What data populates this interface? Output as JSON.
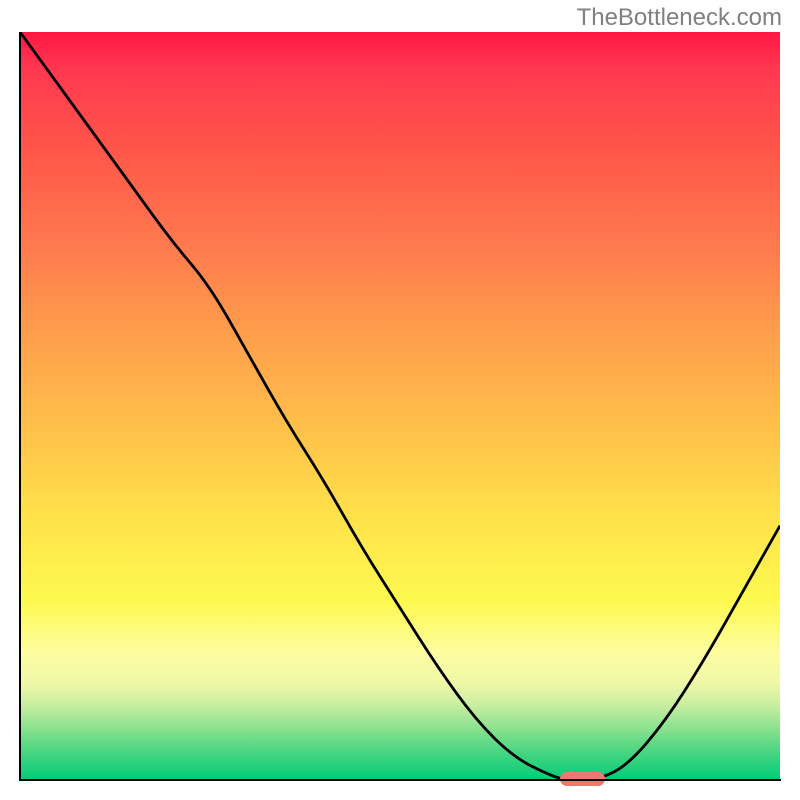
{
  "watermark": "TheBottleneck.com",
  "chart_data": {
    "type": "line",
    "title": "",
    "xlabel": "",
    "ylabel": "",
    "xlim": [
      0,
      100
    ],
    "ylim": [
      0,
      100
    ],
    "grid": false,
    "legend": false,
    "background_gradient": {
      "type": "vertical",
      "stops": [
        {
          "pos": 0,
          "color": "#ff1744",
          "meaning": "high"
        },
        {
          "pos": 50,
          "color": "#ffc04a",
          "meaning": "mid"
        },
        {
          "pos": 100,
          "color": "#00cc78",
          "meaning": "low"
        }
      ]
    },
    "series": [
      {
        "name": "bottleneck-curve",
        "color": "#000000",
        "x": [
          0,
          5,
          10,
          15,
          20,
          25,
          30,
          35,
          40,
          45,
          50,
          55,
          60,
          65,
          70,
          72,
          76,
          80,
          85,
          90,
          95,
          100
        ],
        "y": [
          100,
          93,
          86,
          79,
          72,
          66,
          57,
          48,
          40,
          31,
          23,
          15,
          8,
          3,
          0.5,
          0,
          0,
          2,
          8,
          16,
          25,
          34
        ]
      }
    ],
    "marker": {
      "name": "optimal-marker",
      "x": 74,
      "y": 0,
      "width": 6,
      "color": "#f0776f"
    },
    "axes_visible": false
  }
}
